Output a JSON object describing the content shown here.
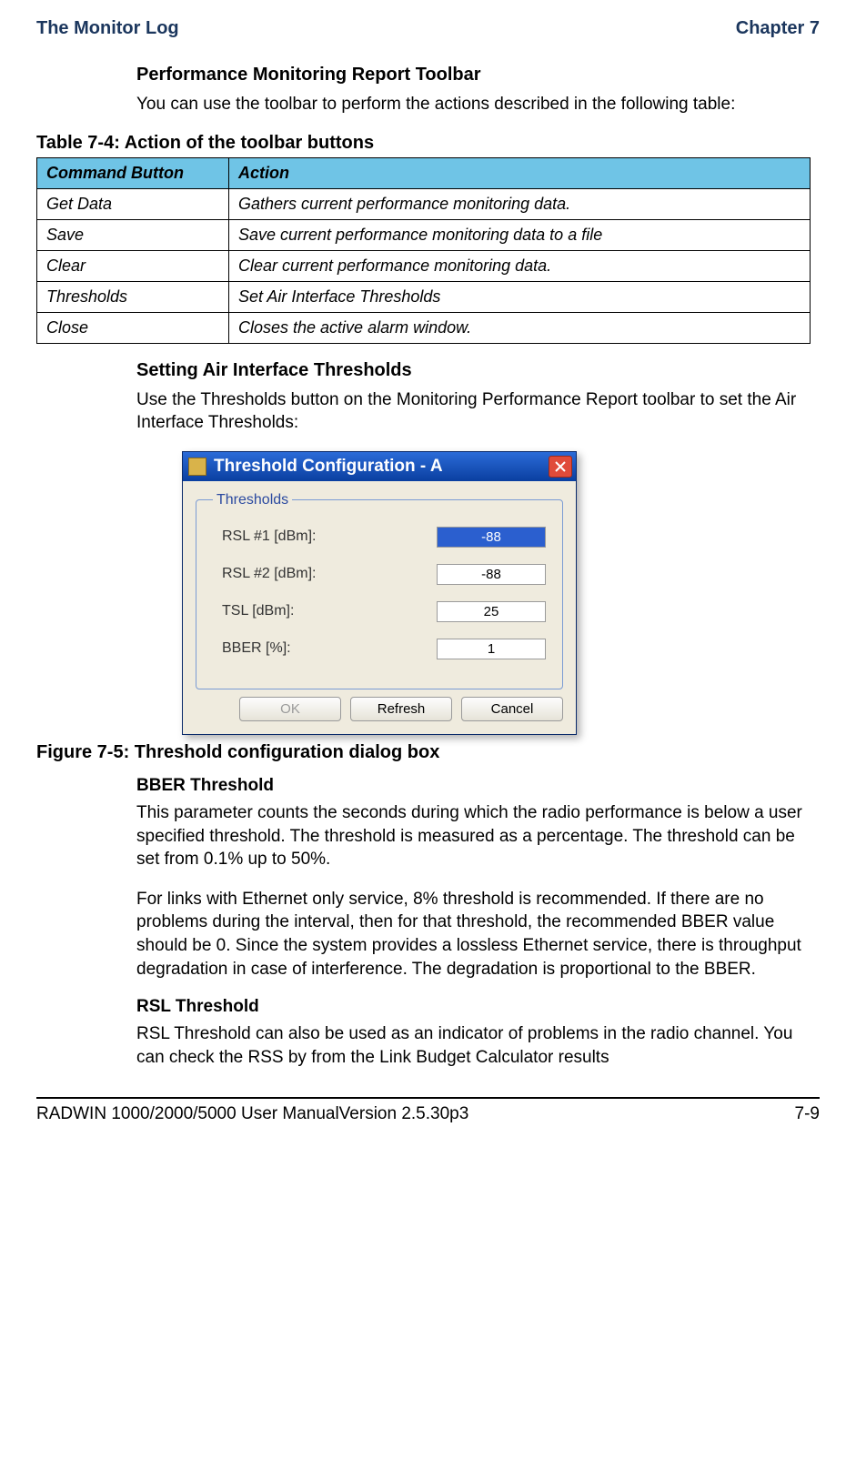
{
  "header": {
    "left": "The Monitor Log",
    "right": "Chapter 7"
  },
  "section1": {
    "title": "Performance Monitoring Report Toolbar",
    "intro": "You can use the toolbar to perform the actions described in the following table:"
  },
  "table": {
    "caption": "Table 7-4: Action of the toolbar buttons",
    "headers": {
      "col1": "Command Button",
      "col2": "Action"
    },
    "rows": [
      {
        "cmd": "Get Data",
        "action": "Gathers current performance monitoring data."
      },
      {
        "cmd": "Save",
        "action": "Save current performance monitoring data to a file"
      },
      {
        "cmd": "Clear",
        "action": "Clear current performance monitoring data."
      },
      {
        "cmd": "Thresholds",
        "action": "Set Air Interface Thresholds"
      },
      {
        "cmd": "Close",
        "action": "Closes the active alarm window."
      }
    ]
  },
  "section2": {
    "title": "Setting Air Interface Thresholds",
    "intro": "Use the Thresholds button on the Monitoring Performance Report toolbar to set the Air Interface Thresholds:"
  },
  "dialog": {
    "title": "Threshold Configuration - A",
    "legend": "Thresholds",
    "fields": {
      "rsl1": {
        "label": "RSL #1 [dBm]:",
        "value": "-88"
      },
      "rsl2": {
        "label": "RSL #2 [dBm]:",
        "value": "-88"
      },
      "tsl": {
        "label": "TSL [dBm]:",
        "value": "25"
      },
      "bber": {
        "label": "BBER [%]:",
        "value": "1"
      }
    },
    "buttons": {
      "ok": "OK",
      "refresh": "Refresh",
      "cancel": "Cancel"
    }
  },
  "figure_caption": "Figure 7-5: Threshold configuration dialog box",
  "bber": {
    "title": "BBER Threshold",
    "p1": "This parameter counts the seconds during which the radio performance is below a user specified threshold. The threshold is measured as a percentage. The threshold can be set from 0.1% up to 50%.",
    "p2": "For links with Ethernet only service, 8% threshold is recommended. If there are no problems during the interval, then for that threshold, the recommended BBER value should be 0. Since the system provides a lossless Ethernet service, there is throughput degradation in case of interference. The degradation is proportional to the BBER."
  },
  "rsl": {
    "title": "RSL Threshold",
    "p1": "RSL Threshold can also be used as an indicator of problems in the radio channel. You can check the RSS by from the Link Budget Calculator results"
  },
  "footer": {
    "left": "RADWIN 1000/2000/5000 User ManualVersion  2.5.30p3",
    "right": "7-9"
  }
}
